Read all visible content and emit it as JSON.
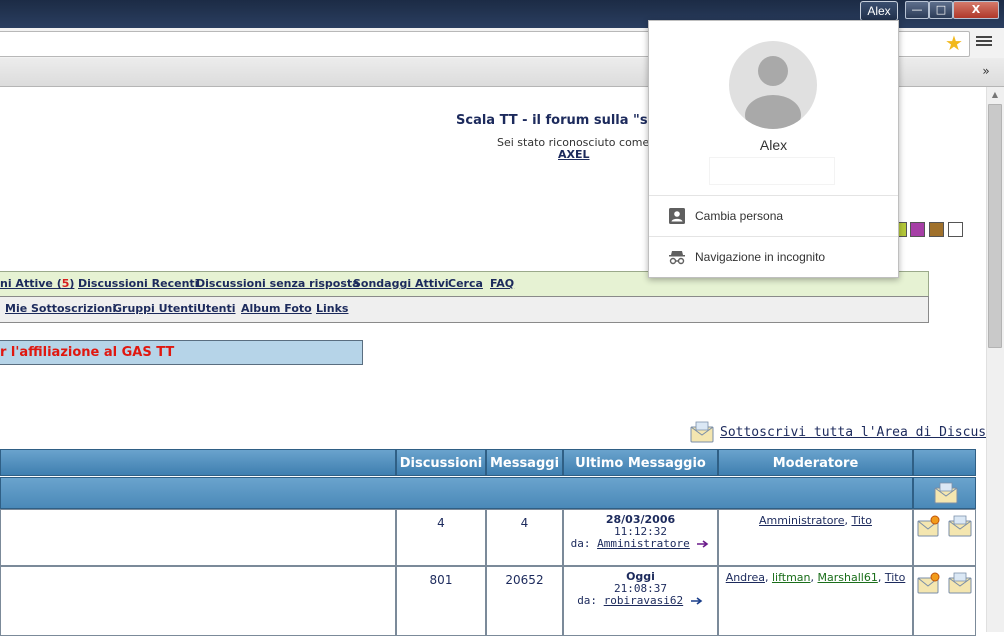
{
  "window": {
    "profile_chip": "Alex",
    "minimize": "—",
    "restore": "□",
    "close": "X"
  },
  "toolbar": {
    "bookmarks_overflow": "»",
    "star_color": "#f2b91c"
  },
  "page": {
    "site_title": "Scala TT - il forum sulla \"sc",
    "logged_as": "Sei stato riconosciuto come",
    "user": "AXEL",
    "swatches": [
      "#b5c83a",
      "#a63fa6",
      "#a0712c",
      "#ffffff"
    ],
    "nav1": {
      "active_prefix": "ni Attive (",
      "active_count": "5",
      "active_suffix": ")",
      "items": [
        "Discussioni Recenti",
        "Discussioni senza risposta",
        "Sondaggi Attivi",
        "Cerca",
        "FAQ"
      ]
    },
    "nav2": {
      "items": [
        "Mie Sottoscrizioni",
        "Gruppi Utenti",
        "Utenti",
        "Album Foto",
        "Links"
      ]
    },
    "affiliation": "r l'affiliazione al GAS TT",
    "subscribe_all": "Sottoscrivi tutta l'Area di Discussione."
  },
  "table": {
    "headers": {
      "discussions": "Discussioni",
      "messages": "Messaggi",
      "last_message": "Ultimo Messaggio",
      "moderator": "Moderatore"
    },
    "rows": [
      {
        "discussions": "4",
        "messages": "4",
        "last_date": "28/03/2006",
        "last_time": "11:12:32",
        "by_prefix": "da:",
        "by_user": "Amministratore",
        "moderators": [
          "Amministratore",
          "Tito"
        ]
      },
      {
        "discussions": "801",
        "messages": "20652",
        "last_date": "Oggi",
        "last_time": "21:08:37",
        "by_prefix": "da:",
        "by_user": "robiravasi62",
        "moderators": [
          "Andrea",
          "liftman",
          "Marshall61",
          "Tito"
        ]
      }
    ]
  },
  "profile_menu": {
    "name": "Alex",
    "switch_person": "Cambia persona",
    "incognito": "Navigazione in incognito"
  }
}
